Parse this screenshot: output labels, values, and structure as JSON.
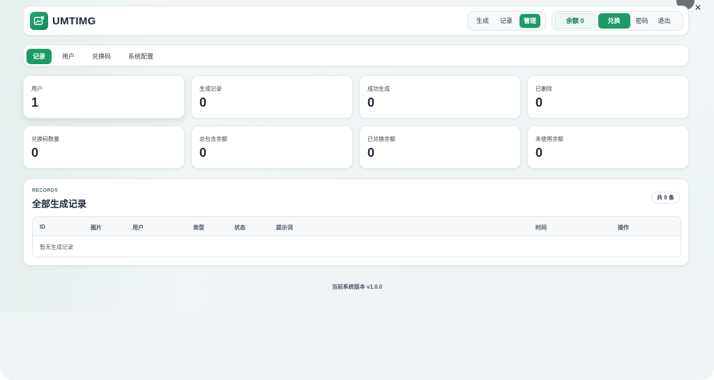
{
  "header": {
    "brand": "UMTIMG",
    "nav": [
      "生成",
      "记录",
      "管理"
    ],
    "active_nav": "管理",
    "balance": "余额 0",
    "exchange": "兑换",
    "secret": "密码",
    "logout": "退出"
  },
  "tabs": [
    "记录",
    "用户",
    "兑换码",
    "系统配置"
  ],
  "stats": [
    {
      "label": "用户",
      "value": "1"
    },
    {
      "label": "生成记录",
      "value": "0"
    },
    {
      "label": "成功生成",
      "value": "0"
    },
    {
      "label": "已删除",
      "value": "0"
    },
    {
      "label": "兑换码数量",
      "value": "0"
    },
    {
      "label": "总包含余额",
      "value": "0"
    },
    {
      "label": "已兑换余额",
      "value": "0"
    },
    {
      "label": "未使用余额",
      "value": "0"
    }
  ],
  "records": {
    "eyebrow": "RECORDS",
    "title": "全部生成记录",
    "count": "共 0 条",
    "columns": [
      "ID",
      "图片",
      "用户",
      "类型",
      "状态",
      "提示词",
      "时间",
      "操作"
    ],
    "empty": "暂无生成记录"
  },
  "footer": "当前系统版本 v1.0.0",
  "colors": {
    "accent": "#1c9a68",
    "text": "#1d2633",
    "bg": "#f1f4f6"
  }
}
